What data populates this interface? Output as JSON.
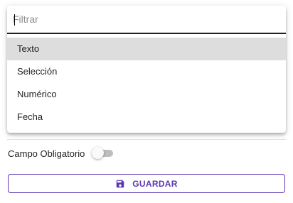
{
  "filter": {
    "placeholder": "Filtrar",
    "value": ""
  },
  "options": [
    {
      "label": "Texto",
      "highlighted": true
    },
    {
      "label": "Selección",
      "highlighted": false
    },
    {
      "label": "Numérico",
      "highlighted": false
    },
    {
      "label": "Fecha",
      "highlighted": false
    }
  ],
  "required_toggle": {
    "label": "Campo Obligatorio",
    "checked": false
  },
  "save_button": {
    "label": "GUARDAR",
    "icon": "save-icon"
  },
  "colors": {
    "accent": "#5e35b1",
    "highlight": "#dddddd",
    "toggle_track": "#bdbdbd"
  }
}
